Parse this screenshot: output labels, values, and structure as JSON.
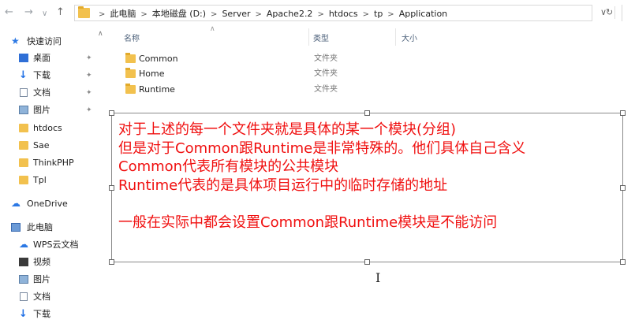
{
  "nav": {
    "back": "←",
    "forward": "→",
    "dropdown": "∨",
    "up": "↑"
  },
  "breadcrumbs": [
    "此电脑",
    "本地磁盘 (D:)",
    "Server",
    "Apache2.2",
    "htdocs",
    "tp",
    "Application"
  ],
  "address_dropdown": "∨",
  "refresh": "↻",
  "search_fragment": "",
  "sidebar": {
    "items": [
      {
        "label": "快速访问",
        "icon": "star-icon",
        "pinned": false
      },
      {
        "label": "桌面",
        "icon": "desktop-icon",
        "pinned": true
      },
      {
        "label": "下载",
        "icon": "download-icon",
        "pinned": true
      },
      {
        "label": "文档",
        "icon": "document-icon",
        "pinned": true
      },
      {
        "label": "图片",
        "icon": "picture-icon",
        "pinned": true
      },
      {
        "label": "htdocs",
        "icon": "folder-icon",
        "pinned": false
      },
      {
        "label": "Sae",
        "icon": "folder-icon",
        "pinned": false
      },
      {
        "label": "ThinkPHP",
        "icon": "folder-icon",
        "pinned": false
      },
      {
        "label": "Tpl",
        "icon": "folder-icon",
        "pinned": false
      },
      {
        "label": "OneDrive",
        "icon": "cloud-icon",
        "pinned": false
      },
      {
        "label": "此电脑",
        "icon": "computer-icon",
        "pinned": false
      },
      {
        "label": "WPS云文档",
        "icon": "wps-cloud-icon",
        "pinned": false
      },
      {
        "label": "视频",
        "icon": "video-icon",
        "pinned": false
      },
      {
        "label": "图片",
        "icon": "picture-icon",
        "pinned": false
      },
      {
        "label": "文档",
        "icon": "document-icon",
        "pinned": false
      },
      {
        "label": "下载",
        "icon": "download-icon",
        "pinned": false
      }
    ],
    "pin_glyph": "📌"
  },
  "columns": {
    "name": "名称",
    "type": "类型",
    "size": "大小"
  },
  "files": [
    {
      "name": "Common",
      "type": "文件夹"
    },
    {
      "name": "Home",
      "type": "文件夹"
    },
    {
      "name": "Runtime",
      "type": "文件夹"
    }
  ],
  "annotation": {
    "lines": [
      "对于上述的每一个文件夹就是具体的某一个模块(分组)",
      "但是对于Common跟Runtime是非常特殊的。他们具体自己含义",
      "Common代表所有模块的公共模块",
      "Runtime代表的是具体项目运行中的临时存储的地址",
      "",
      "一般在实际中都会设置Common跟Runtime模块是不能访问"
    ],
    "color": "#f01010"
  }
}
